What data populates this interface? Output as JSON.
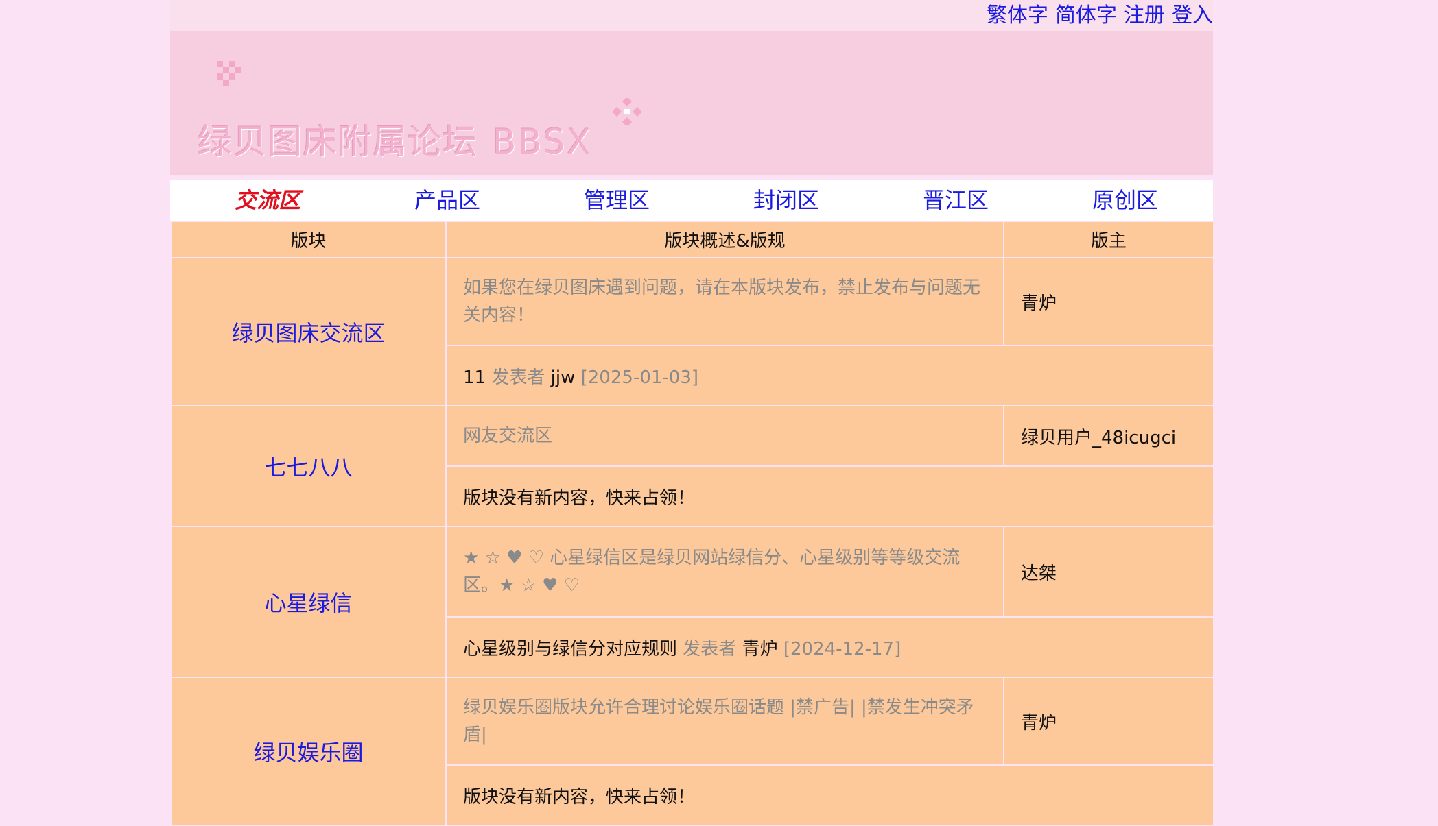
{
  "top_links": [
    "繁体字",
    "简体字",
    "注册",
    "登入"
  ],
  "site": {
    "title_cn": "绿贝图床附属论坛",
    "title_latin": "BBSX"
  },
  "nav": {
    "tabs": [
      "交流区",
      "产品区",
      "管理区",
      "封闭区",
      "晋江区",
      "原创区"
    ],
    "active": "交流区"
  },
  "table": {
    "headers": [
      "版块",
      "版块概述&版规",
      "版主"
    ],
    "boards": [
      {
        "name": "绿贝图床交流区",
        "description": "如果您在绿贝图床遇到问题，请在本版块发布，禁止发布与问题无关内容！",
        "moderator": "青炉",
        "latest": {
          "title": "11",
          "by_label": "发表者",
          "author": "jjw",
          "date": "[2025-01-03]"
        }
      },
      {
        "name": "七七八八",
        "description": "网友交流区",
        "moderator": "绿贝用户_48icugci",
        "latest": {
          "empty": "版块没有新内容，快来占领！"
        }
      },
      {
        "name": "心星绿信",
        "description": "★ ☆ ♥ ♡ 心星绿信区是绿贝网站绿信分、心星级别等等级交流区。★ ☆ ♥ ♡",
        "moderator": "达桀",
        "latest": {
          "title": "心星级别与绿信分对应规则",
          "by_label": "发表者",
          "author": "青炉",
          "date": "[2024-12-17]"
        }
      },
      {
        "name": "绿贝娱乐圈",
        "description": "绿贝娱乐圈版块允许合理讨论娱乐圈话题 |禁广告| |禁发生冲突矛盾|",
        "moderator": "青炉",
        "latest": {
          "empty": "版块没有新内容，快来占领！"
        }
      }
    ]
  },
  "colors": {
    "background": "#fbe2f4",
    "banner": "#f7cde0",
    "table": "#fdc99b",
    "link": "#1a1ae0",
    "active_tab": "#e0101f"
  }
}
